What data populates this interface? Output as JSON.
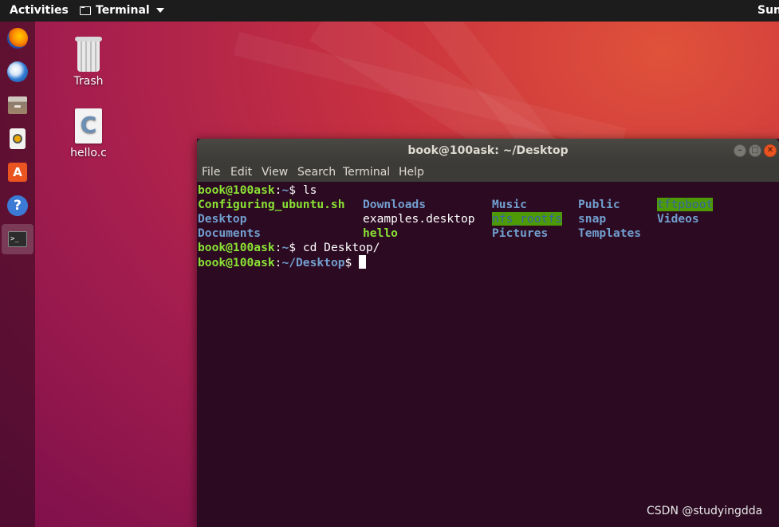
{
  "topbar": {
    "activities": "Activities",
    "app_name": "Terminal",
    "clock": "Sun"
  },
  "dock": {
    "items": [
      {
        "name": "firefox-icon",
        "color": "#e66000"
      },
      {
        "name": "thunderbird-icon",
        "color": "#2f7bd3"
      },
      {
        "name": "files-icon",
        "color": "#a0846a"
      },
      {
        "name": "rhythmbox-icon",
        "color": "#e8a800"
      },
      {
        "name": "software-center-icon",
        "color": "#e95420"
      },
      {
        "name": "help-icon",
        "color": "#3b7bd5"
      },
      {
        "name": "terminal-icon",
        "color": "#2c2c2c"
      }
    ]
  },
  "desktop": {
    "icons": [
      {
        "label": "Trash"
      },
      {
        "label": "hello.c"
      }
    ]
  },
  "window": {
    "title": "book@100ask: ~/Desktop",
    "menu": [
      "File",
      "Edit",
      "View",
      "Search",
      "Terminal",
      "Help"
    ]
  },
  "terminal": {
    "prompt_user": "book@100ask",
    "prompt_home_path": "~",
    "prompt_desktop_path": "~/Desktop",
    "cmd1": "ls",
    "cmd2": "cd Desktop/",
    "ls_rows": [
      [
        "Configuring_ubuntu.sh",
        "Downloads",
        "Music",
        "Public",
        "tftpboot"
      ],
      [
        "Desktop",
        "examples.desktop",
        "nfs_rootfs",
        "snap",
        "Videos"
      ],
      [
        "Documents",
        "hello",
        "Pictures",
        "Templates",
        ""
      ]
    ]
  },
  "colors": {
    "accent": "#e95420",
    "prompt_green": "#8ae234",
    "dir_blue": "#729fcf",
    "terminal_bg": "#2c0a22"
  },
  "watermark": "CSDN @studyingdda"
}
